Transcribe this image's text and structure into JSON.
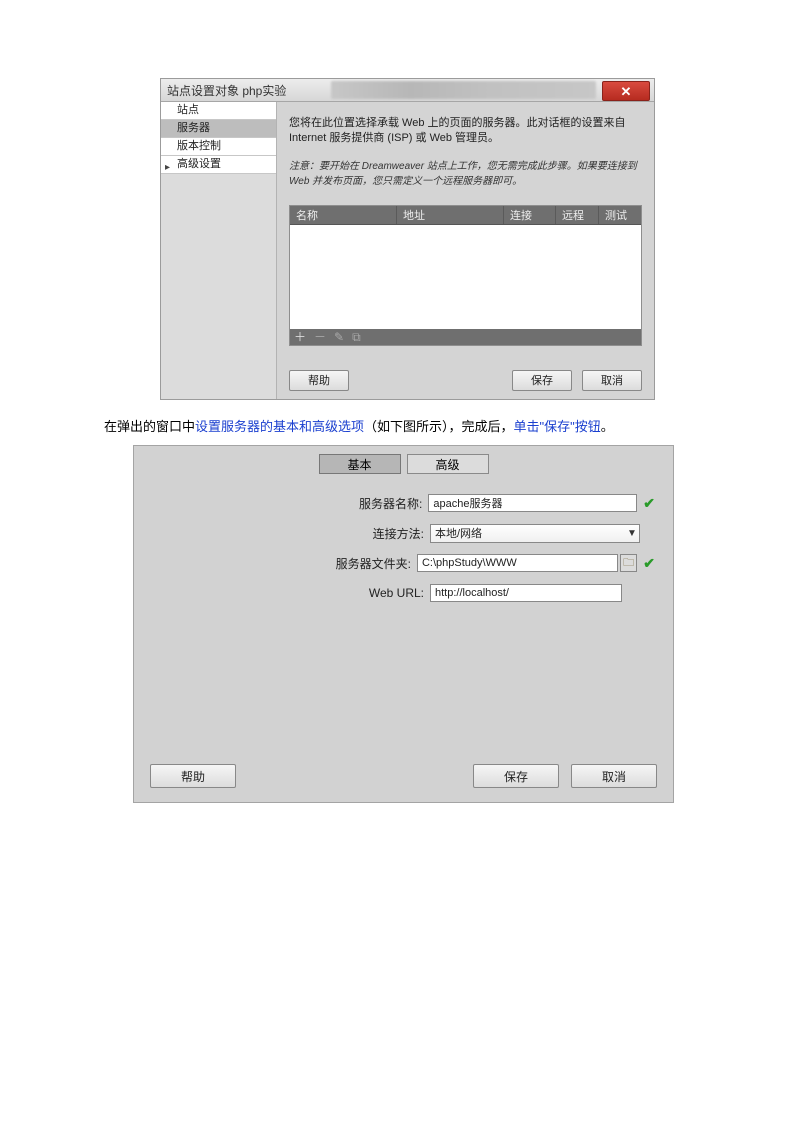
{
  "dialog1": {
    "title": "站点设置对象 php实验",
    "close_glyph": "✕",
    "sidebar": {
      "items": [
        {
          "label": "站点"
        },
        {
          "label": "服务器"
        },
        {
          "label": "版本控制"
        },
        {
          "label": "高级设置"
        }
      ],
      "arrow_glyph": "▸"
    },
    "description": "您将在此位置选择承载 Web 上的页面的服务器。此对话框的设置来自 Internet 服务提供商 (ISP) 或 Web 管理员。",
    "note": "注意：要开始在 Dreamweaver 站点上工作，您无需完成此步骤。如果要连接到 Web 并发布页面，您只需定义一个远程服务器即可。",
    "table": {
      "headers": {
        "name": "名称",
        "address": "地址",
        "connect": "连接",
        "remote": "远程",
        "test": "测试"
      }
    },
    "toolbar": {
      "add": "＋",
      "remove": "－",
      "edit": "✎",
      "dup": "⧉"
    },
    "footer": {
      "help": "帮助",
      "save": "保存",
      "cancel": "取消"
    }
  },
  "caption": {
    "p1": "在弹出的窗口中",
    "blue1": "设置服务器的基本和高级选项",
    "p2": "（如下图所示），完成后，",
    "blue2": "单击\"保存\"按钮",
    "p3": "。"
  },
  "dialog2": {
    "tabs": {
      "basic": "基本",
      "advanced": "高级"
    },
    "labels": {
      "server_name": "服务器名称:",
      "connect_method": "连接方法:",
      "server_folder": "服务器文件夹:",
      "web_url": "Web URL:"
    },
    "values": {
      "server_name": "apache服务器",
      "connect_method": "本地/网络",
      "server_folder": "C:\\phpStudy\\WWW",
      "web_url": "http://localhost/"
    },
    "icons": {
      "check": "✔",
      "folder": "🗀",
      "dropdown": "▼"
    },
    "footer": {
      "help": "帮助",
      "save": "保存",
      "cancel": "取消"
    }
  }
}
